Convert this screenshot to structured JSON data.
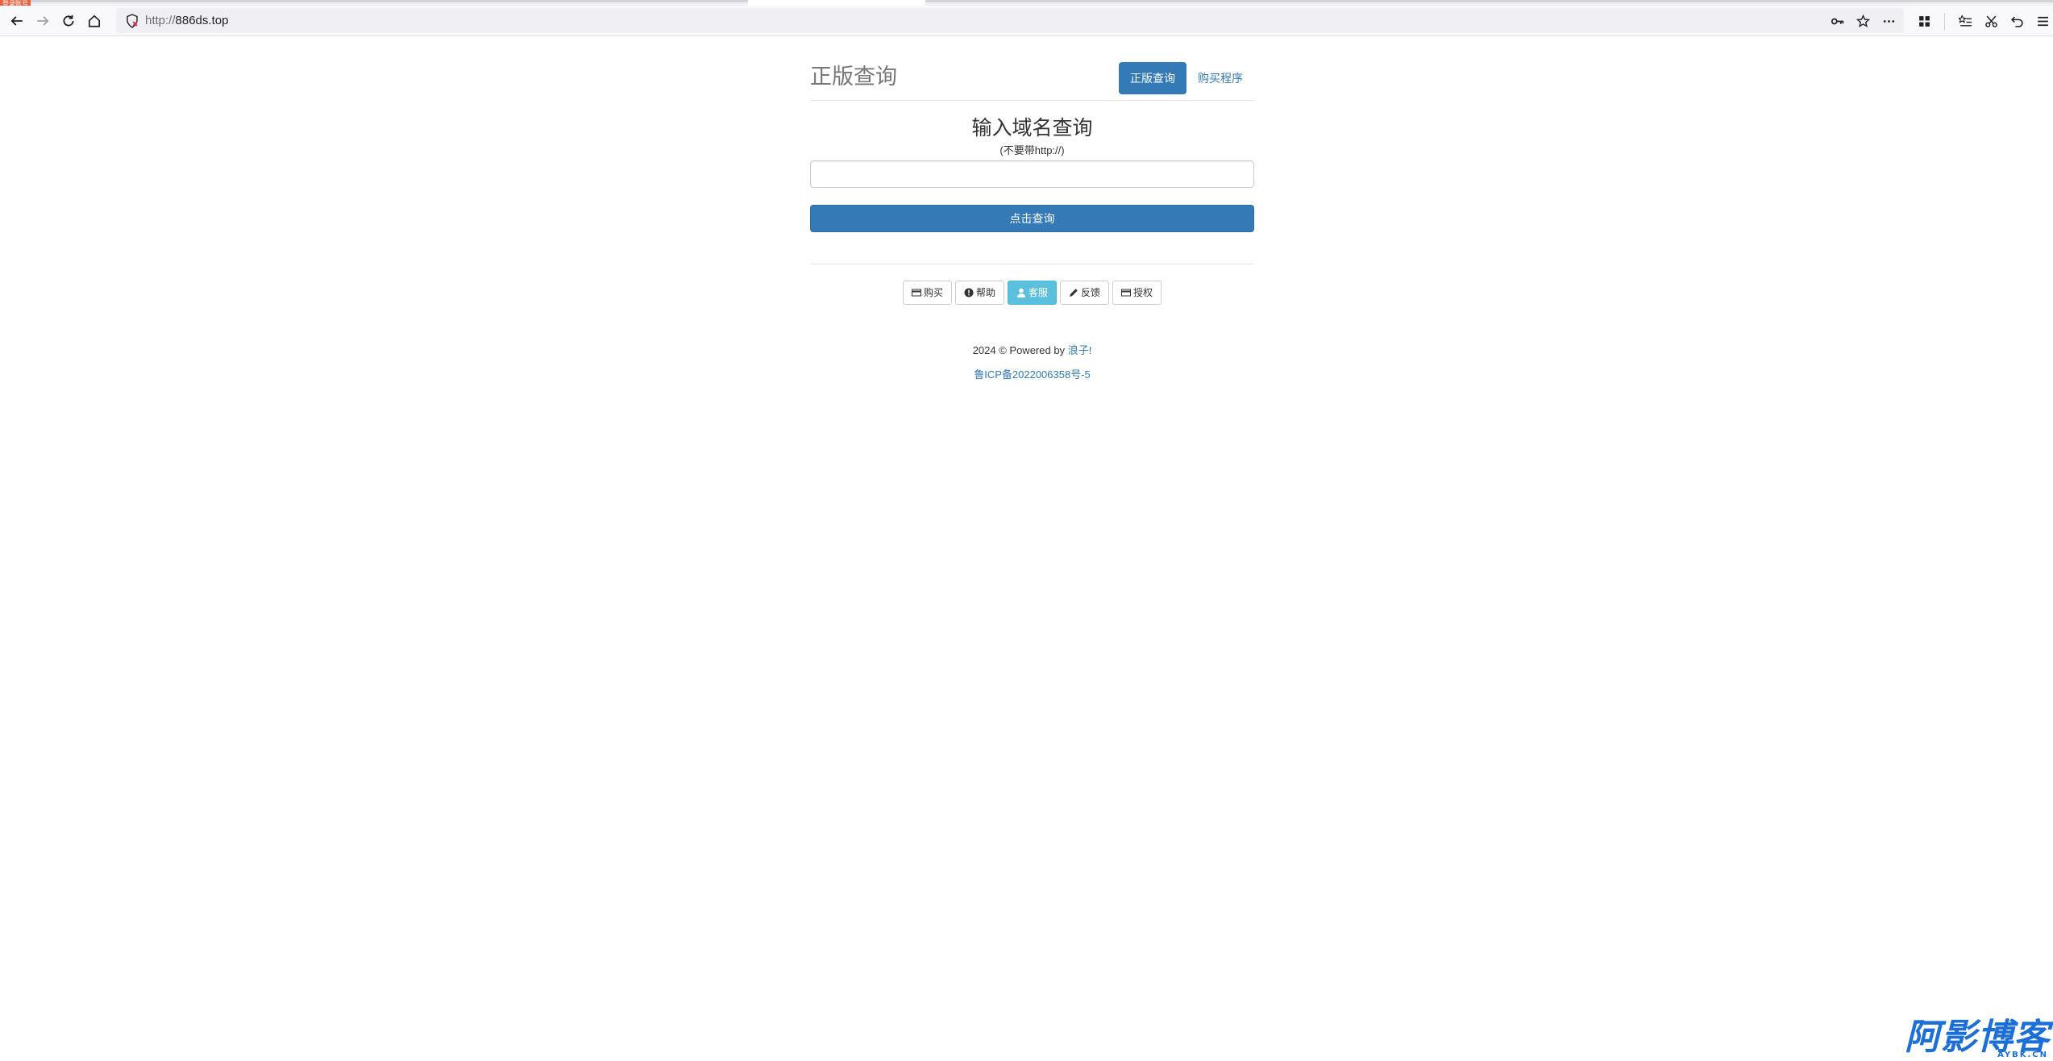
{
  "browser": {
    "badge": "登录账号",
    "url_protocol": "http://",
    "url_host": "886ds.top",
    "icons": {
      "back": "back-arrow-icon",
      "forward": "forward-arrow-icon",
      "reload": "reload-icon",
      "home": "home-icon",
      "security": "insecure-shield-icon",
      "key": "key-icon",
      "bookmark": "star-icon",
      "more": "more-dots-icon",
      "extensions": "grid-icon",
      "reading_list": "reading-list-icon",
      "screenshot": "scissors-icon",
      "undo": "undo-icon",
      "menu": "hamburger-menu-icon"
    }
  },
  "header": {
    "title": "正版查询",
    "nav": [
      {
        "label": "正版查询",
        "active": true
      },
      {
        "label": "购买程序",
        "active": false
      }
    ]
  },
  "query": {
    "heading": "输入域名查询",
    "hint": "(不要带http://)",
    "input_value": "",
    "input_placeholder": "",
    "submit_label": "点击查询"
  },
  "actions": [
    {
      "label": "购买",
      "icon": "card-icon"
    },
    {
      "label": "帮助",
      "icon": "exclamation-circle-icon"
    },
    {
      "label": "客服",
      "icon": "user-icon",
      "active": true
    },
    {
      "label": "反馈",
      "icon": "pencil-icon"
    },
    {
      "label": "授权",
      "icon": "card-icon"
    }
  ],
  "footer": {
    "copyright": "2024 © Powered by",
    "author": "浪子!",
    "icp": "鲁ICP备2022006358号-5"
  },
  "watermark": {
    "main": "阿影博客",
    "sub": "AYBK.CN"
  },
  "colors": {
    "primary": "#337ab7",
    "info": "#5bc0de",
    "watermark": "#1b6fd6"
  }
}
